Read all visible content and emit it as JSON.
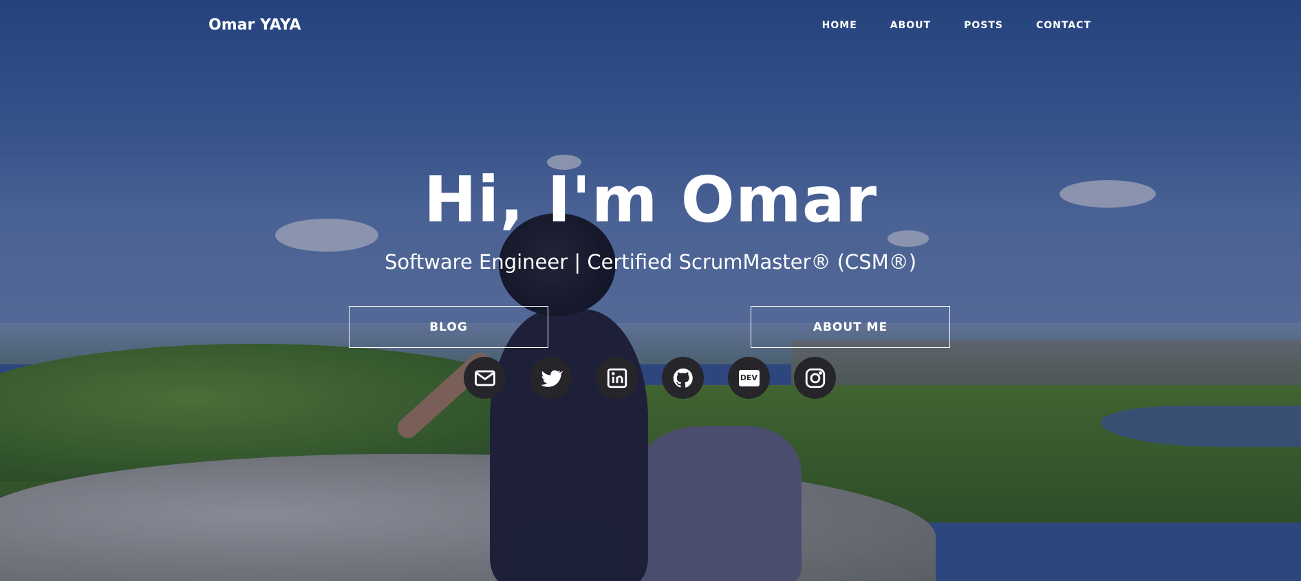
{
  "nav": {
    "brand": "Omar YAYA",
    "links": [
      {
        "label": "HOME"
      },
      {
        "label": "ABOUT"
      },
      {
        "label": "POSTS"
      },
      {
        "label": "CONTACT"
      }
    ]
  },
  "hero": {
    "title": "Hi, I'm Omar",
    "subtitle": "Software Engineer | Certified ScrumMaster® (CSM®)",
    "buttons": {
      "blog": "BLOG",
      "about": "ABOUT ME"
    },
    "dev_badge": "DEV"
  },
  "socials": [
    {
      "icon": "mail-icon"
    },
    {
      "icon": "twitter-icon"
    },
    {
      "icon": "linkedin-icon"
    },
    {
      "icon": "github-icon"
    },
    {
      "icon": "dev-icon"
    },
    {
      "icon": "instagram-icon"
    }
  ],
  "colors": {
    "text": "#ffffff",
    "social_bg": "#25252a",
    "overlay": "rgba(20,30,70,0.38)"
  }
}
